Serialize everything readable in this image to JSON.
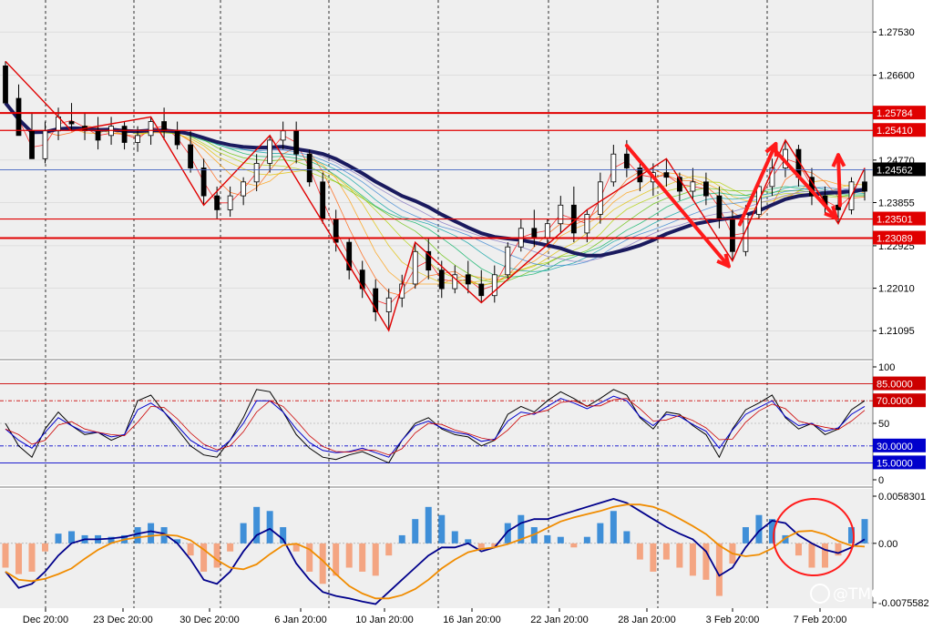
{
  "chart_data": {
    "type": "candlestick",
    "price_panel": {
      "y_ticks": [
        "1.27530",
        "1.26600",
        "1.24770",
        "1.23855",
        "1.22925",
        "1.22010",
        "1.21095"
      ],
      "ylim": [
        1.2055,
        1.2818
      ],
      "current_price": {
        "label": "1.24562",
        "value": 1.24562
      },
      "levels": [
        {
          "label": "1.25784",
          "value": 1.25784
        },
        {
          "label": "1.25410",
          "value": 1.2541
        },
        {
          "label": "1.23501",
          "value": 1.23501
        },
        {
          "label": "1.23089",
          "value": 1.23089
        }
      ],
      "candles": [
        [
          1.268,
          1.269,
          1.264,
          1.26
        ],
        [
          1.261,
          1.264,
          1.255,
          1.253
        ],
        [
          1.254,
          1.258,
          1.249,
          1.248
        ],
        [
          1.248,
          1.256,
          1.247,
          1.254
        ],
        [
          1.254,
          1.259,
          1.252,
          1.257
        ],
        [
          1.256,
          1.26,
          1.254,
          1.2555
        ],
        [
          1.255,
          1.258,
          1.252,
          1.254
        ],
        [
          1.254,
          1.257,
          1.25,
          1.252
        ],
        [
          1.253,
          1.257,
          1.251,
          1.255
        ],
        [
          1.255,
          1.256,
          1.25,
          1.2515
        ],
        [
          1.2515,
          1.255,
          1.2495,
          1.253
        ],
        [
          1.253,
          1.257,
          1.251,
          1.256
        ],
        [
          1.256,
          1.259,
          1.252,
          1.254
        ],
        [
          1.254,
          1.256,
          1.25,
          1.251
        ],
        [
          1.251,
          1.254,
          1.245,
          1.246
        ],
        [
          1.246,
          1.248,
          1.238,
          1.24
        ],
        [
          1.24,
          1.242,
          1.235,
          1.237
        ],
        [
          1.237,
          1.242,
          1.2355,
          1.24
        ],
        [
          1.24,
          1.244,
          1.238,
          1.243
        ],
        [
          1.243,
          1.249,
          1.241,
          1.247
        ],
        [
          1.247,
          1.253,
          1.245,
          1.252
        ],
        [
          1.252,
          1.256,
          1.25,
          1.254
        ],
        [
          1.254,
          1.256,
          1.247,
          1.249
        ],
        [
          1.249,
          1.25,
          1.242,
          1.243
        ],
        [
          1.243,
          1.245,
          1.234,
          1.235
        ],
        [
          1.235,
          1.237,
          1.228,
          1.23
        ],
        [
          1.23,
          1.231,
          1.222,
          1.224
        ],
        [
          1.224,
          1.226,
          1.218,
          1.22
        ],
        [
          1.22,
          1.222,
          1.213,
          1.215
        ],
        [
          1.215,
          1.22,
          1.211,
          1.218
        ],
        [
          1.218,
          1.223,
          1.216,
          1.221
        ],
        [
          1.221,
          1.23,
          1.22,
          1.228
        ],
        [
          1.228,
          1.231,
          1.222,
          1.224
        ],
        [
          1.224,
          1.226,
          1.218,
          1.22
        ],
        [
          1.22,
          1.225,
          1.219,
          1.223
        ],
        [
          1.223,
          1.226,
          1.219,
          1.221
        ],
        [
          1.221,
          1.224,
          1.217,
          1.2185
        ],
        [
          1.2185,
          1.225,
          1.217,
          1.223
        ],
        [
          1.223,
          1.23,
          1.222,
          1.229
        ],
        [
          1.229,
          1.235,
          1.228,
          1.233
        ],
        [
          1.233,
          1.237,
          1.229,
          1.231
        ],
        [
          1.231,
          1.235,
          1.229,
          1.234
        ],
        [
          1.234,
          1.24,
          1.232,
          1.238
        ],
        [
          1.238,
          1.242,
          1.23,
          1.232
        ],
        [
          1.232,
          1.237,
          1.23,
          1.236
        ],
        [
          1.236,
          1.245,
          1.234,
          1.243
        ],
        [
          1.243,
          1.251,
          1.242,
          1.249
        ],
        [
          1.249,
          1.252,
          1.244,
          1.246
        ],
        [
          1.246,
          1.248,
          1.241,
          1.243
        ],
        [
          1.243,
          1.247,
          1.24,
          1.245
        ],
        [
          1.245,
          1.248,
          1.242,
          1.244
        ],
        [
          1.244,
          1.245,
          1.239,
          1.241
        ],
        [
          1.241,
          1.246,
          1.239,
          1.243
        ],
        [
          1.243,
          1.245,
          1.238,
          1.24
        ],
        [
          1.24,
          1.242,
          1.233,
          1.235
        ],
        [
          1.235,
          1.237,
          1.226,
          1.228
        ],
        [
          1.228,
          1.238,
          1.227,
          1.236
        ],
        [
          1.236,
          1.243,
          1.235,
          1.242
        ],
        [
          1.242,
          1.248,
          1.24,
          1.246
        ],
        [
          1.246,
          1.252,
          1.244,
          1.25
        ],
        [
          1.25,
          1.251,
          1.242,
          1.244
        ],
        [
          1.244,
          1.246,
          1.238,
          1.24
        ],
        [
          1.24,
          1.242,
          1.236,
          1.238
        ],
        [
          1.238,
          1.24,
          1.234,
          1.237
        ],
        [
          1.237,
          1.244,
          1.236,
          1.243
        ],
        [
          1.243,
          1.246,
          1.239,
          1.241
        ]
      ]
    },
    "stochastic_panel": {
      "y_ticks": [
        "100",
        "50",
        "0"
      ],
      "ylim": [
        0,
        100
      ],
      "levels": [
        {
          "label": "85.0000",
          "value": 85
        },
        {
          "label": "70.0000",
          "value": 70
        },
        {
          "label": "30.0000",
          "value": 30
        },
        {
          "label": "15.0000",
          "value": 15
        }
      ],
      "series": [
        {
          "values": [
            50,
            30,
            20,
            45,
            60,
            48,
            40,
            42,
            35,
            40,
            70,
            75,
            60,
            45,
            30,
            22,
            20,
            35,
            55,
            80,
            78,
            60,
            40,
            28,
            20,
            18,
            22,
            25,
            20,
            15,
            35,
            50,
            55,
            45,
            40,
            38,
            30,
            35,
            58,
            65,
            60,
            70,
            78,
            72,
            65,
            72,
            80,
            75,
            55,
            45,
            60,
            58,
            48,
            40,
            20,
            45,
            62,
            68,
            75,
            55,
            45,
            50,
            40,
            45,
            62,
            70
          ]
        },
        {
          "values": [
            45,
            35,
            28,
            42,
            55,
            48,
            42,
            42,
            38,
            40,
            62,
            68,
            60,
            48,
            35,
            28,
            25,
            35,
            50,
            70,
            70,
            60,
            45,
            33,
            26,
            24,
            25,
            28,
            24,
            20,
            35,
            48,
            52,
            46,
            42,
            40,
            34,
            36,
            52,
            60,
            58,
            65,
            72,
            68,
            63,
            68,
            74,
            70,
            56,
            48,
            58,
            56,
            49,
            43,
            28,
            44,
            58,
            64,
            70,
            56,
            48,
            50,
            43,
            46,
            58,
            65
          ]
        }
      ]
    },
    "macd_panel": {
      "y_ticks": [
        "0.0058301",
        "0.00",
        "-0.0075582"
      ],
      "ylim": [
        -0.0075582,
        0.0058301
      ],
      "histogram": [
        -0.003,
        -0.0038,
        -0.0035,
        -0.001,
        0.0012,
        0.0015,
        0.001,
        0.001,
        0.0008,
        0.001,
        0.002,
        0.0025,
        0.002,
        0.0005,
        -0.0015,
        -0.0035,
        -0.003,
        -0.001,
        0.0025,
        0.0045,
        0.004,
        0.002,
        -0.001,
        -0.0035,
        -0.005,
        -0.004,
        -0.003,
        -0.0035,
        -0.004,
        -0.0015,
        0.001,
        0.003,
        0.0045,
        0.0035,
        0.0015,
        0.0005,
        -0.0008,
        -0.0005,
        0.0025,
        0.0035,
        0.002,
        0.001,
        0.0008,
        -0.0005,
        0.0008,
        0.0025,
        0.004,
        0.0015,
        -0.002,
        -0.0035,
        -0.002,
        -0.003,
        -0.004,
        -0.0045,
        -0.0065,
        -0.0025,
        0.002,
        0.0035,
        0.003,
        0.001,
        -0.0015,
        -0.003,
        -0.003,
        -0.0015,
        0.002,
        0.003
      ],
      "macd": [
        -0.0035,
        -0.0055,
        -0.005,
        -0.0035,
        -0.0015,
        0.0,
        0.0005,
        0.0005,
        0.0006,
        0.0008,
        0.0012,
        0.0015,
        0.0012,
        0.0,
        -0.002,
        -0.0045,
        -0.005,
        -0.0035,
        -0.001,
        0.001,
        0.0018,
        0.0005,
        -0.0025,
        -0.0045,
        -0.006,
        -0.0065,
        -0.0068,
        -0.0072,
        -0.0075,
        -0.006,
        -0.0045,
        -0.003,
        -0.0015,
        -0.0005,
        -0.0005,
        0.0,
        -0.001,
        -0.0005,
        0.0015,
        0.0025,
        0.003,
        0.003,
        0.0035,
        0.004,
        0.0045,
        0.005,
        0.0055,
        0.005,
        0.004,
        0.003,
        0.002,
        0.0012,
        0.0005,
        -0.001,
        -0.004,
        -0.003,
        -0.0005,
        0.0015,
        0.0028,
        0.0025,
        0.001,
        0.0,
        -0.0008,
        -0.0012,
        -0.0005,
        0.0005
      ]
    },
    "x_ticks": [
      "Dec 20:00",
      "23 Dec 20:00",
      "30 Dec 20:00",
      "6 Jan 20:00",
      "10 Jan 20:00",
      "16 Jan 20:00",
      "22 Jan 20:00",
      "28 Jan 20:00",
      "3 Feb 20:00",
      "7 Feb 20:00"
    ],
    "colors": {
      "support_resistance": "#e00000",
      "current_price_line": "#4060c0",
      "stoch_main": "#000000",
      "stoch_signal": "#0000cc",
      "stoch_signal2": "#cc0000",
      "macd_positive": "#3f8fd8",
      "macd_negative": "#f4a582",
      "macd_line": "#00008b",
      "signal_line": "#f08c00",
      "slow_ma": "#1a1a5e",
      "annotation": "#ff1a1a"
    }
  },
  "watermark": "@TMGM"
}
